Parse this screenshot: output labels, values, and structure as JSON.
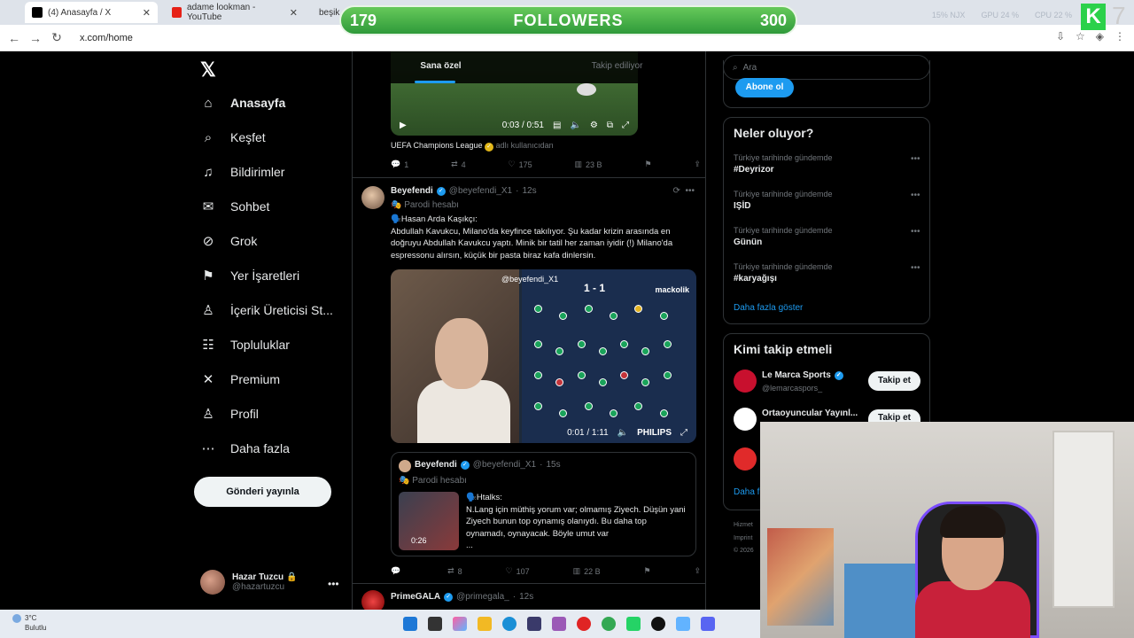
{
  "browser": {
    "tabs": [
      {
        "label": "(4) Anasayfa / X",
        "active": true
      },
      {
        "label": "adame lookman - YouTube",
        "active": false
      },
      {
        "label": "beşik",
        "active": false
      }
    ],
    "url": "x.com/home",
    "stats": [
      "15% NJX",
      "GPU 24 %",
      "CPU 22 %"
    ]
  },
  "overlay": {
    "followers_current": "179",
    "followers_label": "FOLLOWERS",
    "followers_goal": "300",
    "k_logo": "K",
    "k_num": "7"
  },
  "nav": {
    "items": [
      {
        "label": "Anasayfa",
        "icon": "home-icon",
        "glyph": "⌂"
      },
      {
        "label": "Keşfet",
        "icon": "search-icon",
        "glyph": "⌕"
      },
      {
        "label": "Bildirimler",
        "icon": "bell-icon",
        "glyph": "♫"
      },
      {
        "label": "Sohbet",
        "icon": "mail-icon",
        "glyph": "✉"
      },
      {
        "label": "Grok",
        "icon": "grok-icon",
        "glyph": "⊘"
      },
      {
        "label": "Yer İşaretleri",
        "icon": "bookmark-icon",
        "glyph": "⚑"
      },
      {
        "label": "İçerik Üreticisi St...",
        "icon": "creator-icon",
        "glyph": "♙"
      },
      {
        "label": "Topluluklar",
        "icon": "communities-icon",
        "glyph": "☷"
      },
      {
        "label": "Premium",
        "icon": "x-premium-icon",
        "glyph": "✕"
      },
      {
        "label": "Profil",
        "icon": "profile-icon",
        "glyph": "♙"
      },
      {
        "label": "Daha fazla",
        "icon": "more-circle-icon",
        "glyph": "⋯"
      }
    ],
    "post_button": "Gönderi yayınla",
    "user": {
      "name": "Hazar Tuzcu",
      "handle": "@hazartuzcu"
    }
  },
  "timeline": {
    "tabs": [
      "Sana özel",
      "Takip ediliyor"
    ],
    "video1": {
      "time": "0:03 / 0:51"
    },
    "source": {
      "name": "UEFA Champions League",
      "suffix": "adlı kullanıcıdan"
    },
    "actions1": {
      "replies": "1",
      "reposts": "4",
      "likes": "175",
      "views": "23 B"
    },
    "tweet": {
      "name": "Beyefendi",
      "handle": "@beyefendi_X1",
      "time": "12s",
      "parody": "Parodi hesabı",
      "lines": [
        "🗣️Hasan Arda Kaşıkçı:",
        "Abdullah Kavukcu, Milano'da keyfince takılıyor. Şu kadar krizin arasında en doğruyu Abdullah Kavukcu yaptı. Minik bir tatil her zaman iyidir (!) Milano'da espressonu alırsın, küçük bir pasta biraz kafa dinlersin."
      ],
      "video": {
        "watermark": "@beyefendi_X1",
        "score": "1 - 1",
        "brand": "mackolik",
        "time": "0:01 / 1:11",
        "sponsor": "PHILIPS"
      }
    },
    "quote": {
      "name": "Beyefendi",
      "handle": "@beyefendi_X1",
      "time": "15s",
      "parody": "Parodi hesabı",
      "thumb_time": "0:26",
      "text_lines": [
        "🗣️Htalks:",
        "N.Lang için müthiş yorum var; olmamış Ziyech. Düşün yani Ziyech bunun top oynamış olanıydı. Bu daha top oynamadı, oynayacak. Böyle umut var",
        "..."
      ]
    },
    "actions2": {
      "replies": "",
      "reposts": "8",
      "likes": "107",
      "views": "22 B"
    },
    "next_tweet": {
      "name": "PrimeGALA",
      "handle": "@primegala_",
      "time": "12s"
    }
  },
  "sidebar": {
    "search_placeholder": "Ara",
    "subscribe": "Abone ol",
    "trends_title": "Neler oluyor?",
    "trends": [
      {
        "context": "Türkiye tarihinde gündemde",
        "name": "#Deyrizor"
      },
      {
        "context": "Türkiye tarihinde gündemde",
        "name": "IŞİD"
      },
      {
        "context": "Türkiye tarihinde gündemde",
        "name": "Günün"
      },
      {
        "context": "Türkiye tarihinde gündemde",
        "name": "#karyağışı"
      }
    ],
    "show_more": "Daha fazla göster",
    "wtf_title": "Kimi takip etmeli",
    "wtf": [
      {
        "name": "Le Marca Sports",
        "handle": "@lemarcaspors_",
        "button": "Takip et"
      },
      {
        "name": "Ortaoyuncular Yayınl...",
        "handle": "",
        "button": "Takip et"
      }
    ],
    "more_link": "Daha f",
    "footer": [
      "Hizmet",
      "Imprint",
      "© 2026"
    ]
  },
  "taskbar": {
    "temp": "3°C",
    "weather": "Bulutlu"
  }
}
